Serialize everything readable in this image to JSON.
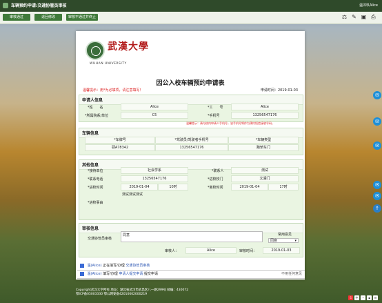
{
  "window": {
    "title": "车辆预约申请:交通协管员审核",
    "user": "温沐玖Alice"
  },
  "toolbar": {
    "buttons": [
      "审核通过",
      "退回修改",
      "审核不通过并终止"
    ]
  },
  "form": {
    "logo_cn": "武漢大學",
    "logo_en": "WUHAN UNIVERSITY",
    "title": "因公入校车辆预约申请表",
    "hint": "温馨提示：用*为必填项，请注意填写！",
    "apply_time_label": "申请时间：",
    "apply_time": "2019-01-03",
    "applicant": {
      "section": "申请人信息",
      "name_label": "*姓　　名",
      "name": "Alice",
      "id_label": "*工　　号",
      "id": "Alice",
      "dept_label": "*所属院系/单位",
      "dept": "C5",
      "phone_label": "*手机号",
      "phone": "13256547176",
      "warn": "温馨提示：请与校内申请人手机号，该手机号将作为预约短信接收号码。"
    },
    "vehicle": {
      "section": "车辆信息",
      "headers": [
        "*车牌号",
        "*驾驶员/驾驶者手机号",
        "*车辆类型"
      ],
      "values": [
        "鄂A78342",
        "13256547176",
        "跑轿车门"
      ]
    },
    "other": {
      "section": "其他信息",
      "unit_label": "*接待单位",
      "unit": "社会学系",
      "contact_label": "*联系人",
      "contact": "测试",
      "tel_label": "*联系电话",
      "tel": "13256547176",
      "gate_label": "*进校校门",
      "gate": "文澜门",
      "entry_label": "*进校时间",
      "entry_date": "2019-01-04",
      "entry_hour": "10时",
      "leave_label": "*离校时间",
      "leave_date": "2019-01-04",
      "leave_hour": "17时",
      "reason_label": "*进校事由",
      "reason": "测试测试测试"
    },
    "audit": {
      "section": "审核信息",
      "opinion_label": "交通协管员审核",
      "opinion": "同意",
      "common_label": "常用意见",
      "common_value": "同意",
      "auditor_label": "审核人：",
      "auditor": "Alice",
      "time_label": "审核时间：",
      "time": "2019-01-03"
    }
  },
  "notices": [
    {
      "who": "温(Alice)",
      "text": "正在填写/办理",
      "link": "交通协管员审核",
      "tail": ""
    },
    {
      "who": "温(Alice)",
      "text": "填写/办理",
      "link": "申请人提交申请",
      "sep": "提交申请",
      "tail": "不用任何意见"
    }
  ],
  "footer": [
    "Copyright武汉大学所有  地址：湖北省武汉市武昌区八一路299号  邮编：430072",
    "鄂ICP备05003330  鄂公网安备42010602000219"
  ]
}
